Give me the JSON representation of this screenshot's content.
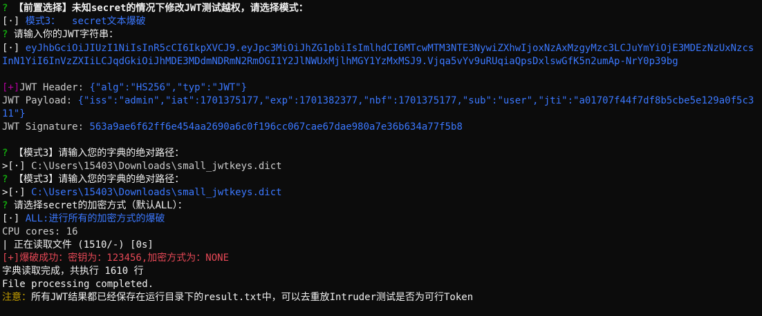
{
  "colors": {
    "background": "#0c0c0c",
    "text": "#cccccc",
    "prompt_green": "#13a10e",
    "value_blue": "#3b78ff",
    "success_red": "#e74856",
    "header_magenta": "#b4009e",
    "note_yellow": "#c19c00"
  },
  "lines": {
    "l1": {
      "mark": "?",
      "text": "【前置选择】未知secret的情况下修改JWT测试越权，请选择模式："
    },
    "l2": {
      "mark": "[·]",
      "value": "模式3：  secret文本爆破"
    },
    "l3": {
      "mark": "?",
      "text": "请输入你的JWT字符串："
    },
    "l4": {
      "mark": "[·]",
      "value": "eyJhbGciOiJIUzI1NiIsInR5cCI6IkpXVCJ9.eyJpc3MiOiJhZG1pbiIsImlhdCI6MTcwMTM3NTE3NywiZXhwIjoxNzAxMzgyMzc3LCJuYmYiOjE3MDEzNzUxNzcsInN1YiI6InVzZXIiLCJqdGkiOiJhMDE3MDdmNDRmN2RmOGI1Y2JlNWUxMjlhMGY1YzMxMSJ9.Vjqa5vYv9uRUqiaQpsDxlswGfK5n2umAp-NrY0p39bg"
    },
    "l5": {
      "mark": "[+]",
      "label": "JWT Header: ",
      "value": "{\"alg\":\"HS256\",\"typ\":\"JWT\"}"
    },
    "l6": {
      "label": "JWT Payload: ",
      "value": "{\"iss\":\"admin\",\"iat\":1701375177,\"exp\":1701382377,\"nbf\":1701375177,\"sub\":\"user\",\"jti\":\"a01707f44f7df8b5cbe5e129a0f5c311\"}"
    },
    "l7": {
      "label": "JWT Signature: ",
      "value": "563a9ae6f62ff6e454aa2690a6c0f196cc067cae67dae980a7e36b634a77f5b8"
    },
    "l8": {
      "mark": "?",
      "text": "【模式3】请输入您的字典的绝对路径："
    },
    "l9": {
      "mark": ">[·]",
      "value": "C:\\Users\\15403\\Downloads\\small_jwtkeys.dict"
    },
    "l10": {
      "mark": "?",
      "text": "【模式3】请输入您的字典的绝对路径："
    },
    "l11": {
      "mark": ">[·]",
      "value": "C:\\Users\\15403\\Downloads\\small_jwtkeys.dict"
    },
    "l12": {
      "mark": "?",
      "text": "请选择secret的加密方式（默认ALL）："
    },
    "l13": {
      "mark": "[·]",
      "value": "ALL:进行所有的加密方式的爆破"
    },
    "l14": {
      "text": "CPU cores: 16"
    },
    "l15": {
      "text": "| 正在读取文件 (1510/-) [0s]"
    },
    "l16": {
      "text": "[+]爆破成功：密钥为：123456,加密方式为：NONE"
    },
    "l17": {
      "text": "字典读取完成，共执行 1610 行"
    },
    "l18": {
      "text": "File processing completed."
    },
    "l19": {
      "label": "注意：",
      "text": "所有JWT结果都已经保存在运行目录下的result.txt中，可以去重放Intruder测试是否为可行Token"
    }
  }
}
